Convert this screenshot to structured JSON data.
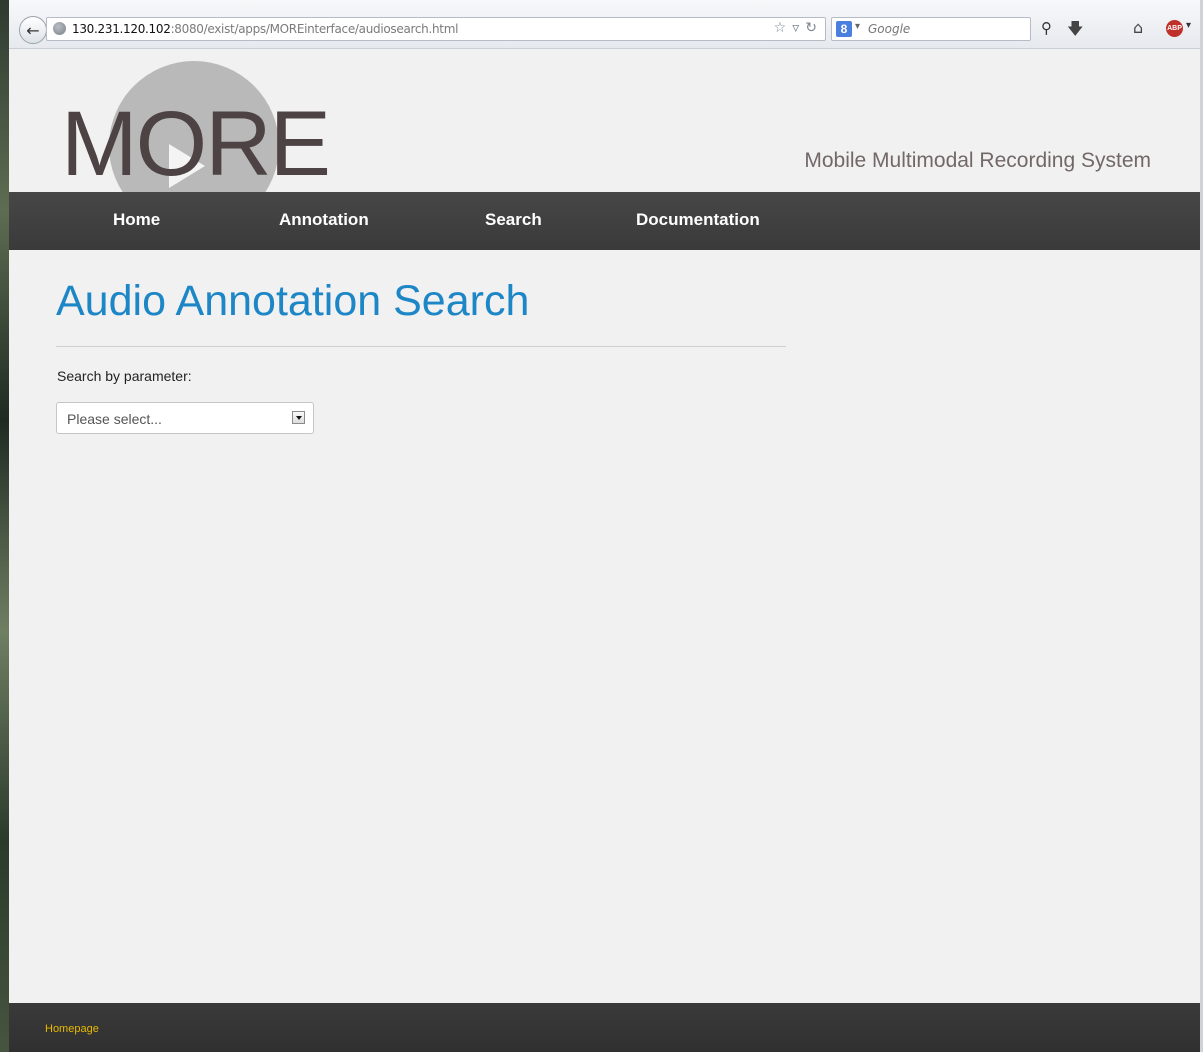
{
  "browser": {
    "url_host": "130.231.120.102",
    "url_rest": ":8080/exist/apps/MOREinterface/audiosearch.html",
    "search_engine": "8",
    "search_placeholder": "Google",
    "abp_label": "ABP"
  },
  "header": {
    "logo_text": "MORE",
    "tagline": "Mobile Multimodal Recording System"
  },
  "nav": {
    "items": [
      {
        "label": "Home"
      },
      {
        "label": "Annotation"
      },
      {
        "label": "Search"
      },
      {
        "label": "Documentation"
      }
    ]
  },
  "main": {
    "title": "Audio Annotation Search",
    "param_label": "Search by parameter:",
    "select_value": "Please select..."
  },
  "footer": {
    "link": "Homepage"
  },
  "colors": {
    "title": "#1c86c6",
    "nav_bg": "#3f3f3f",
    "footer_link": "#e8b800"
  }
}
